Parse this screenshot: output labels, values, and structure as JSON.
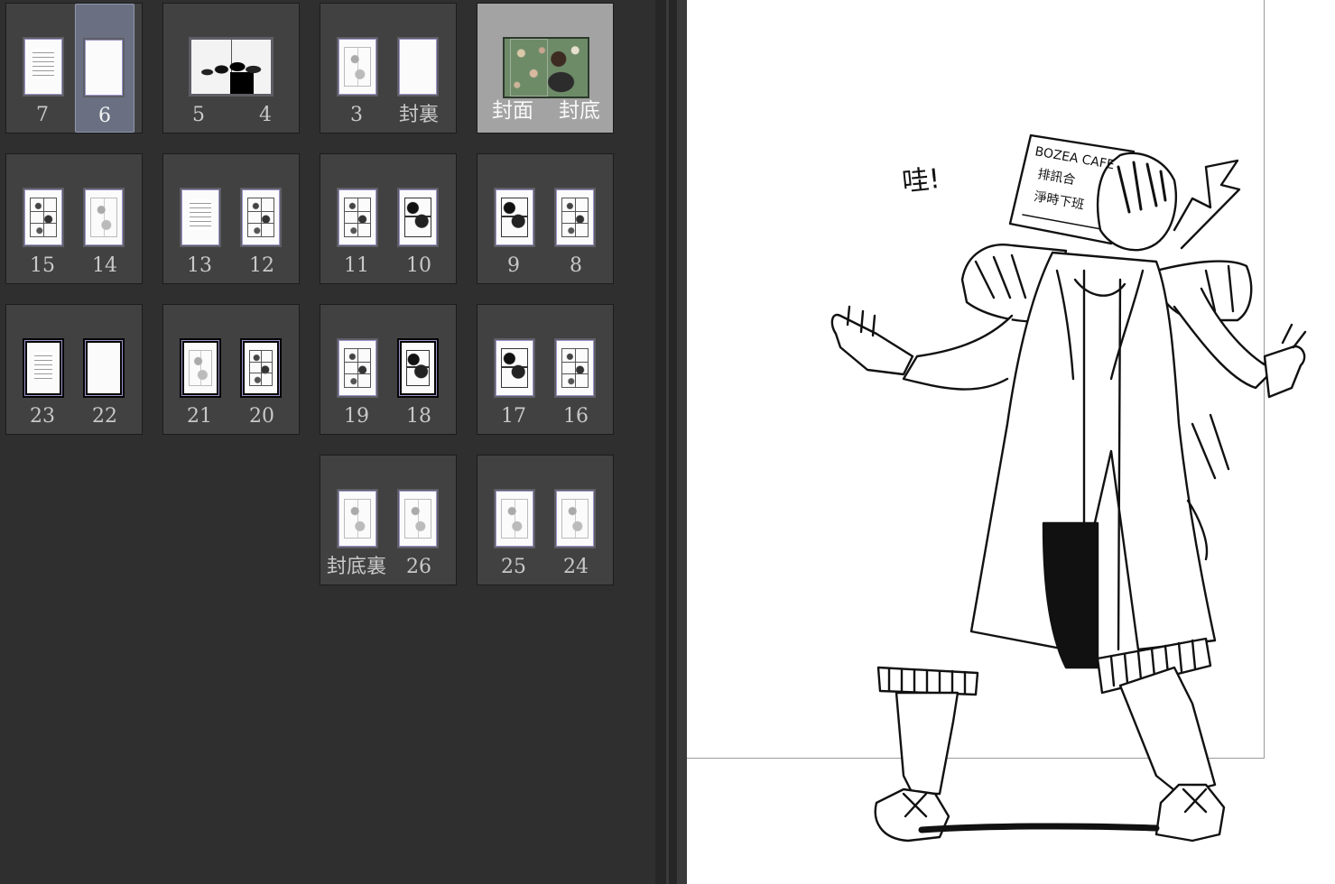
{
  "page_panel": {
    "spreads": [
      {
        "left": "7",
        "right": "6",
        "left_art": "text",
        "right_art": "blank",
        "active": "right"
      },
      {
        "wide": true,
        "left": "5",
        "right": "4"
      },
      {
        "left": "3",
        "right": "封裏",
        "left_art": "light",
        "right_art": "blank"
      },
      {
        "cover": true,
        "left": "封面",
        "right": "封底",
        "selected": true
      },
      {
        "left": "15",
        "right": "14",
        "left_art": "panels",
        "right_art": "light"
      },
      {
        "left": "13",
        "right": "12",
        "left_art": "text",
        "right_art": "panels"
      },
      {
        "left": "11",
        "right": "10",
        "left_art": "panels",
        "right_art": "dark"
      },
      {
        "left": "9",
        "right": "8",
        "left_art": "dark",
        "right_art": "panels"
      },
      {
        "left": "23",
        "right": "22",
        "left_art": "text",
        "right_art": "blank",
        "left_black": true,
        "right_black": true
      },
      {
        "left": "21",
        "right": "20",
        "left_art": "light",
        "right_art": "panels",
        "left_black": true,
        "right_black": true
      },
      {
        "left": "19",
        "right": "18",
        "left_art": "panels",
        "right_art": "dark",
        "right_black": true
      },
      {
        "left": "17",
        "right": "16",
        "left_art": "dark",
        "right_art": "panels"
      },
      {
        "left": "封底裏",
        "right": "26",
        "left_art": "light",
        "right_art": "light"
      },
      {
        "left": "25",
        "right": "24",
        "left_art": "light",
        "right_art": "light"
      }
    ]
  },
  "canvas": {
    "sfx_text": "哇!",
    "sign_lines": [
      "BOZEA CAFE",
      "排訊合",
      "淨時下班"
    ]
  },
  "colors": {
    "panel_bg": "#2f2f2f",
    "spread_bg": "#414141",
    "selected_spread_bg": "#a3a3a3",
    "active_page_bg": "#6a7082",
    "canvas_bg": "#ffffff"
  }
}
